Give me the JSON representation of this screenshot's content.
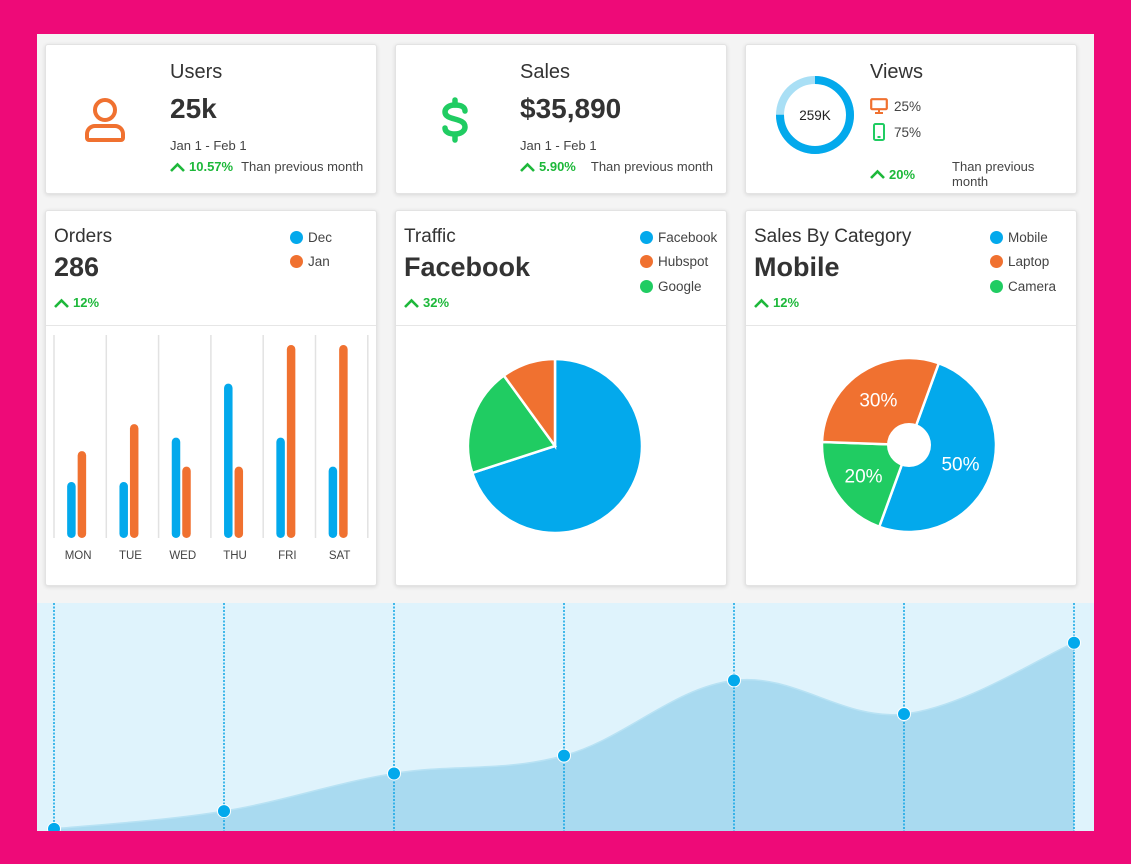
{
  "colors": {
    "frame": "#ee0a78",
    "blue": "#03a9ec",
    "orange": "#f07130",
    "green": "#20cc62",
    "trend_green": "#1db83a",
    "light_blue": "#a9dbf1",
    "area_bg": "#dff3fc"
  },
  "stats": [
    {
      "icon": "user-icon",
      "title": "Users",
      "value": "25k",
      "date": "Jan 1 - Feb 1",
      "trend": "10.57%",
      "note": "Than previous month"
    },
    {
      "icon": "dollar-icon",
      "title": "Sales",
      "value": "$35,890",
      "date": "Jan 1 - Feb 1",
      "trend": "5.90%",
      "note": "Than previous month"
    },
    {
      "title": "Views",
      "donut_label": "259K",
      "donut_fraction": 0.75,
      "devices": [
        {
          "icon": "desktop-icon",
          "value": "25%"
        },
        {
          "icon": "mobile-icon",
          "value": "75%"
        }
      ],
      "trend": "20%",
      "note": "Than previous month"
    }
  ],
  "orders": {
    "title": "Orders",
    "value": "286",
    "trend": "12%"
  },
  "traffic": {
    "title": "Traffic",
    "value": "Facebook",
    "trend": "32%"
  },
  "category": {
    "title": "Sales By Category",
    "value": "Mobile",
    "trend": "12%"
  },
  "chart_data": [
    {
      "type": "bar",
      "title": "Orders",
      "categories": [
        "MON",
        "TUE",
        "WED",
        "THU",
        "FRI",
        "SAT"
      ],
      "series": [
        {
          "name": "Dec",
          "color": "#03a9ec",
          "values": [
            29,
            29,
            52,
            80,
            52,
            37
          ]
        },
        {
          "name": "Jan",
          "color": "#f07130",
          "values": [
            45,
            59,
            37,
            37,
            100,
            100
          ]
        }
      ],
      "ylim": [
        0,
        100
      ],
      "grid": "vertical",
      "legend": "top-right"
    },
    {
      "type": "pie",
      "title": "Traffic",
      "labels": [
        "Facebook",
        "Hubspot",
        "Google"
      ],
      "values": [
        70,
        10,
        20
      ],
      "colors": [
        "#03a9ec",
        "#f07130",
        "#20cc62"
      ],
      "legend": "top-right"
    },
    {
      "type": "pie",
      "title": "Sales By Category",
      "labels": [
        "Mobile",
        "Laptop",
        "Camera"
      ],
      "values": [
        50,
        30,
        20
      ],
      "value_labels": [
        "50%",
        "30%",
        "20%"
      ],
      "colors": [
        "#03a9ec",
        "#f07130",
        "#20cc62"
      ],
      "legend": "top-right"
    },
    {
      "type": "area",
      "title": "",
      "x": [
        0,
        1,
        2,
        3,
        4,
        5,
        6
      ],
      "values": [
        -5,
        4,
        23,
        32,
        70,
        53,
        89
      ],
      "ylim": [
        0,
        100
      ],
      "grid": "vertical-dotted"
    }
  ]
}
